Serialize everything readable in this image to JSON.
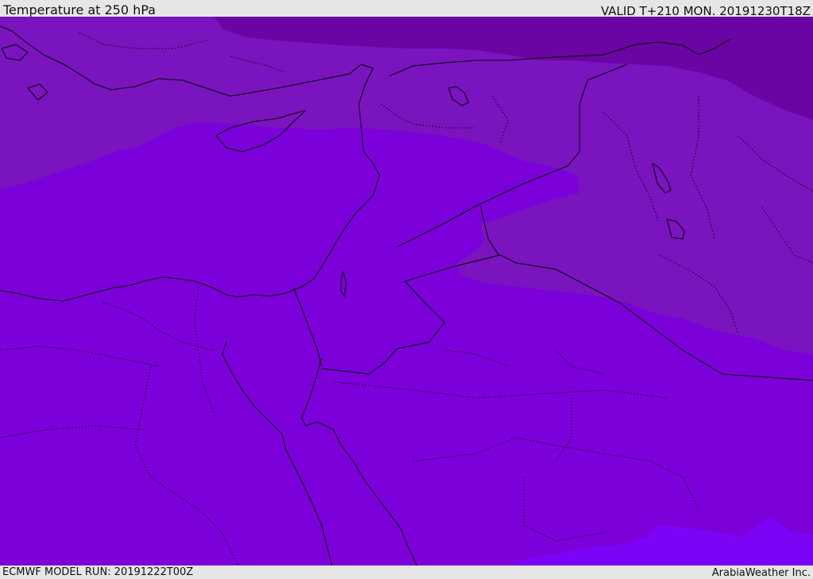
{
  "header": {
    "title": "Temperature at 250 hPa",
    "valid": "VALID T+210 MON. 20191230T18Z"
  },
  "footer": {
    "model_run": "ECMWF MODEL RUN: 20191222T00Z",
    "credit": "ArabiaWeather Inc."
  },
  "map": {
    "colors": {
      "base": "#7b00d9",
      "band_mid": "#7a14bf",
      "band_cold": "#6a04a2",
      "band_warm": "#7c04f6",
      "coast": "#000000"
    }
  }
}
